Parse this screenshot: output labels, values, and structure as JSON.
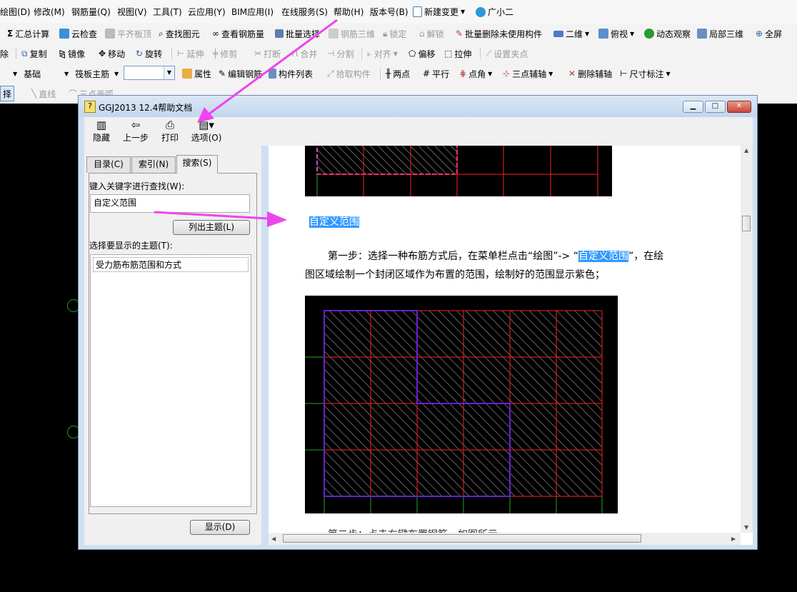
{
  "menubar": {
    "items": [
      "绘图(D)",
      "修改(M)",
      "钢筋量(Q)",
      "视图(V)",
      "工具(T)",
      "云应用(Y)",
      "BIM应用(I)",
      "在线服务(S)",
      "帮助(H)",
      "版本号(B)",
      "新建变更",
      "广小二"
    ]
  },
  "toolbar1": {
    "items": [
      "汇总计算",
      "云检查",
      "平齐板顶",
      "查找图元",
      "查看钢筋量",
      "批量选择",
      "钢筋三维",
      "锁定",
      "解锁",
      "批量删除未使用构件",
      "二维",
      "俯视",
      "动态观察",
      "局部三维",
      "全屏"
    ]
  },
  "toolbar2": {
    "items": [
      "除",
      "复制",
      "镜像",
      "移动",
      "旋转",
      "延伸",
      "修剪",
      "打断",
      "合并",
      "分割",
      "对齐",
      "偏移",
      "拉伸",
      "设置夹点"
    ]
  },
  "toolbar3": {
    "combo1": "基础",
    "combo2": "筏板主筋",
    "items": [
      "属性",
      "编辑钢筋",
      "构件列表",
      "拾取构件",
      "两点",
      "平行",
      "点角",
      "三点辅轴",
      "删除辅轴",
      "尺寸标注"
    ]
  },
  "toolbar4": {
    "items": [
      "择",
      "直线",
      "三点画弧"
    ]
  },
  "help_window": {
    "title": "GGJ2013 12.4帮助文档",
    "toolbar": [
      "隐藏",
      "上一步",
      "打印",
      "选项(O)"
    ],
    "tabs": [
      "目录(C)",
      "索引(N)",
      "搜索(S)"
    ],
    "keyword_label": "键入关键字进行查找(W):",
    "keyword_value": "自定义范围",
    "list_topics_button": "列出主题(L)",
    "topics_label": "选择要显示的主题(T):",
    "topics": [
      "受力筋布筋范围和方式"
    ],
    "display_button": "显示(D)"
  },
  "content": {
    "heading": "自定义范围",
    "step1_before": "第一步：选择一种布筋方式后，在菜单栏点击“绘图”-> “",
    "step1_highlight": "自定义范围",
    "step1_after": "”，在绘",
    "step1_line2": "图区域绘制一个封闭区域作为布置的范围，绘制好的范围显示紫色；",
    "step2_partial": "第二步：点击右键布置钢筋，如图所示"
  },
  "colors": {
    "annotation_arrow": "#ee44ee",
    "highlight": "#3399ff",
    "region_purple": "#6a1fd1",
    "grid_red": "#ff2020",
    "grid_green": "#22aa22"
  }
}
